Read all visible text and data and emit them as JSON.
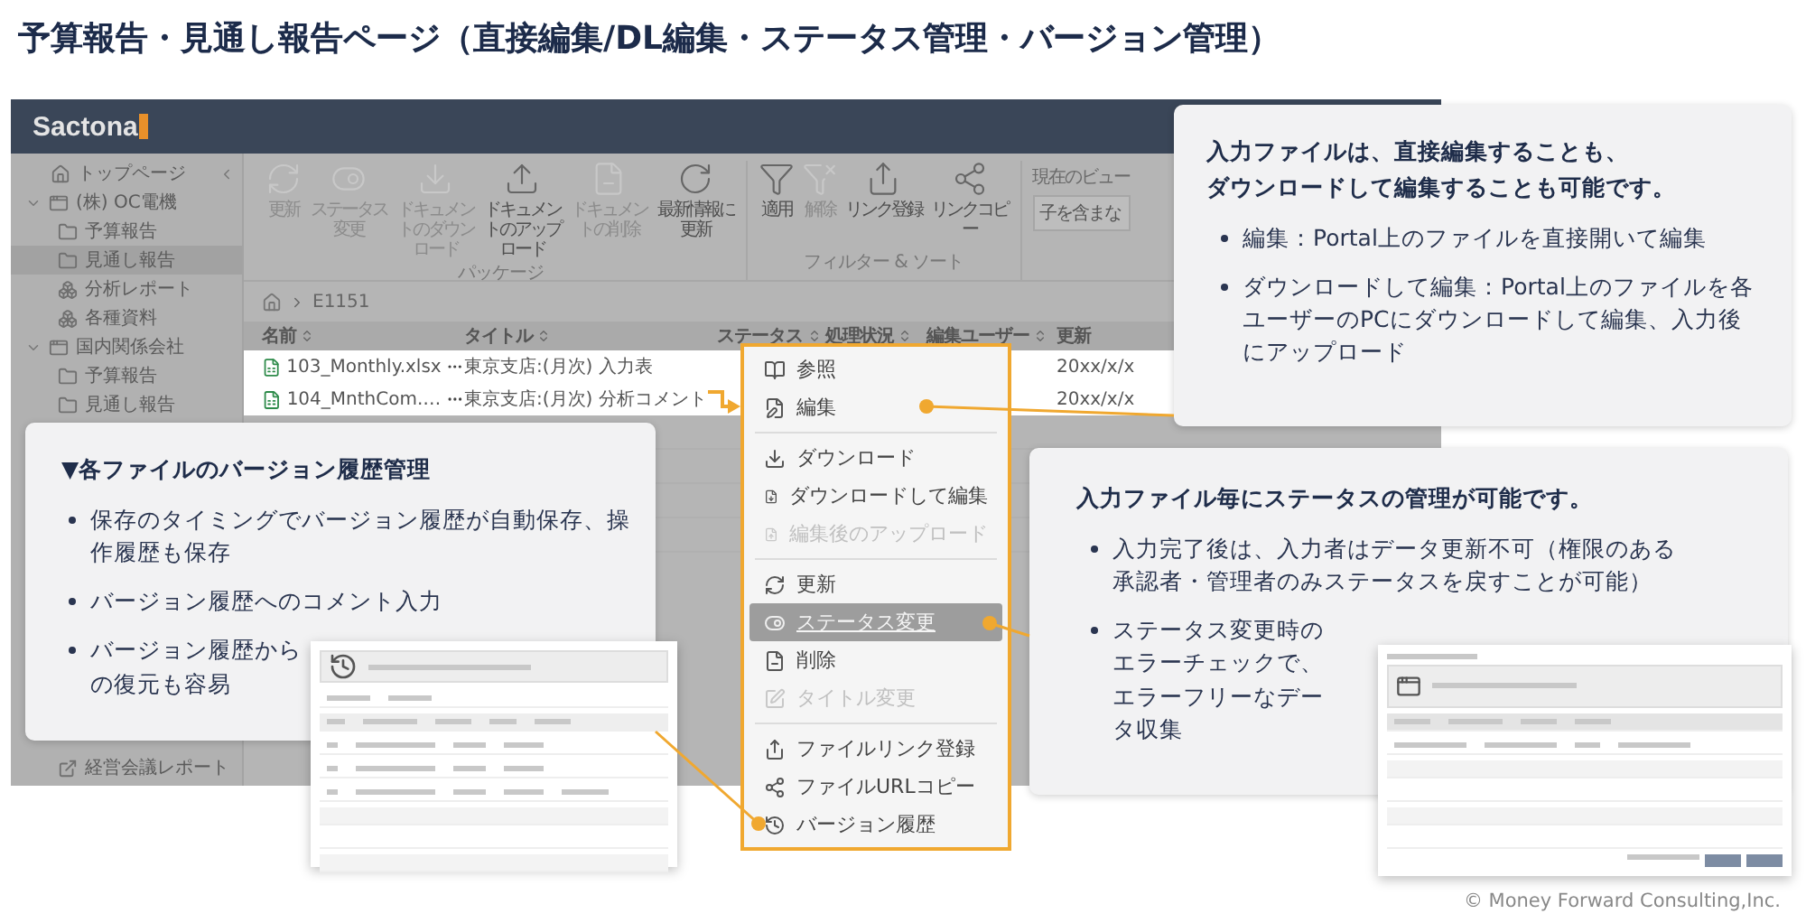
{
  "title": "予算報告・見通し報告ページ（直接編集/DL編集・ステータス管理・バージョン管理）",
  "app": {
    "logo": "Sactona",
    "sidebar": {
      "items": [
        {
          "label": "トップページ",
          "kind": "home",
          "selected": false
        },
        {
          "label": "(株) OC電機",
          "kind": "company",
          "expanded": true,
          "selected": false,
          "children": [
            {
              "label": "予算報告",
              "kind": "folder",
              "selected": false
            },
            {
              "label": "見通し報告",
              "kind": "folder",
              "selected": true
            },
            {
              "label": "分析レポート",
              "kind": "report",
              "selected": false
            },
            {
              "label": "各種資料",
              "kind": "report",
              "selected": false
            }
          ]
        },
        {
          "label": "国内関係会社",
          "kind": "company",
          "expanded": true,
          "selected": false,
          "children": [
            {
              "label": "予算報告",
              "kind": "folder",
              "selected": false
            },
            {
              "label": "見通し報告",
              "kind": "folder",
              "selected": false
            }
          ]
        }
      ],
      "bottom_item": {
        "label": "経営会議レポート",
        "kind": "link",
        "selected": false
      }
    },
    "toolbar": {
      "groups": [
        {
          "caption": "パッケージ",
          "buttons": [
            {
              "label": "更新",
              "disabled": true
            },
            {
              "label": "ステータス変更",
              "disabled": true
            },
            {
              "label": "ドキュメントのダウンロード",
              "disabled": true
            },
            {
              "label": "ドキュメントのアップロード",
              "disabled": false
            },
            {
              "label": "ドキュメントの削除",
              "disabled": true
            },
            {
              "label": "最新情報に更新",
              "disabled": false
            }
          ]
        },
        {
          "caption": "フィルター & ソート",
          "buttons": [
            {
              "label": "適用",
              "disabled": false
            },
            {
              "label": "解除",
              "disabled": true
            },
            {
              "label": "リンク登録",
              "disabled": false
            },
            {
              "label": "リンクコピー",
              "disabled": false
            }
          ]
        }
      ],
      "view": {
        "label": "現在のビュー",
        "value": "子を含まな"
      }
    },
    "breadcrumb": [
      "E1151"
    ],
    "table": {
      "columns": [
        "名前",
        "タイトル",
        "ステータス",
        "処理状況",
        "編集ユーザー",
        "更新"
      ],
      "rows": [
        {
          "name": "103_Monthly.xlsx",
          "title": "東京支店:(月次) 入力表",
          "date": "20xx/x/x"
        },
        {
          "name": "104_MnthCom.…",
          "title": "東京支店:(月次) 分析コメント",
          "date": "20xx/x/x"
        }
      ]
    }
  },
  "menu": {
    "groups": [
      [
        {
          "label": "参照",
          "disabled": false,
          "selected": false
        },
        {
          "label": "編集",
          "disabled": false,
          "selected": false
        }
      ],
      [
        {
          "label": "ダウンロード",
          "disabled": false,
          "selected": false
        },
        {
          "label": "ダウンロードして編集",
          "disabled": false,
          "selected": false
        },
        {
          "label": "編集後のアップロード",
          "disabled": true,
          "selected": false
        }
      ],
      [
        {
          "label": "更新",
          "disabled": false,
          "selected": false
        },
        {
          "label": "ステータス変更",
          "disabled": false,
          "selected": true
        },
        {
          "label": "削除",
          "disabled": false,
          "selected": false
        },
        {
          "label": "タイトル変更",
          "disabled": true,
          "selected": false
        }
      ],
      [
        {
          "label": "ファイルリンク登録",
          "disabled": false,
          "selected": false
        },
        {
          "label": "ファイルURLコピー",
          "disabled": false,
          "selected": false
        },
        {
          "label": "バージョン履歴",
          "disabled": false,
          "selected": false
        }
      ]
    ]
  },
  "callouts": [
    {
      "title": [
        "入力ファイルは、直接編集することも、",
        "ダウンロードして編集することも可能です。"
      ],
      "bullets": [
        "編集：Portal上のファイルを直接開いて編集",
        "ダウンロードして編集：Portal上のファイルを各ユーザーのPCにダウンロードして編集、入力後にアップロード"
      ]
    },
    {
      "title": [
        "▼各ファイルのバージョン履歴管理"
      ],
      "bullets": [
        "保存のタイミングでバージョン履歴が自動保存、操作履歴も保存",
        "バージョン履歴へのコメント入力",
        "バージョン履歴からの復元も容易"
      ]
    },
    {
      "title": [
        "入力ファイル毎にステータスの管理が可能です。"
      ],
      "bullets": [
        "入力完了後は、入力者はデータ更新不可（権限のある承認者・管理者のみステータスを戻すことが可能）",
        "ステータス変更時のエラーチェックで、エラーフリーなデータ収集"
      ]
    }
  ],
  "copyright": "© Money Forward Consulting,Inc."
}
